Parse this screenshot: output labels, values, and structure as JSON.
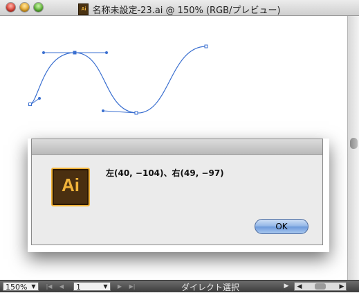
{
  "window": {
    "title": "名称未設定-23.ai @ 150% (RGB/プレビュー)",
    "doc_icon_text": "Ai"
  },
  "dialog": {
    "app_icon_text": "Ai",
    "message": "左(40, −104)、右(49, −97)",
    "ok_label": "OK"
  },
  "statusbar": {
    "zoom": "150%",
    "page": "1",
    "tool_name": "ダイレクト選択"
  },
  "colors": {
    "path_stroke": "#3a6fd0",
    "ai_icon_bg": "#4a2f10",
    "ai_icon_accent": "#f2b43a",
    "ok_button": "#8fb4e6"
  },
  "icons": [
    "close-light",
    "minimize-light",
    "zoom-light",
    "illustrator-icon",
    "chevron-down-icon",
    "first-page-icon",
    "prev-page-icon",
    "next-page-icon",
    "last-page-icon",
    "arrow-right-icon",
    "arrow-left-icon"
  ]
}
